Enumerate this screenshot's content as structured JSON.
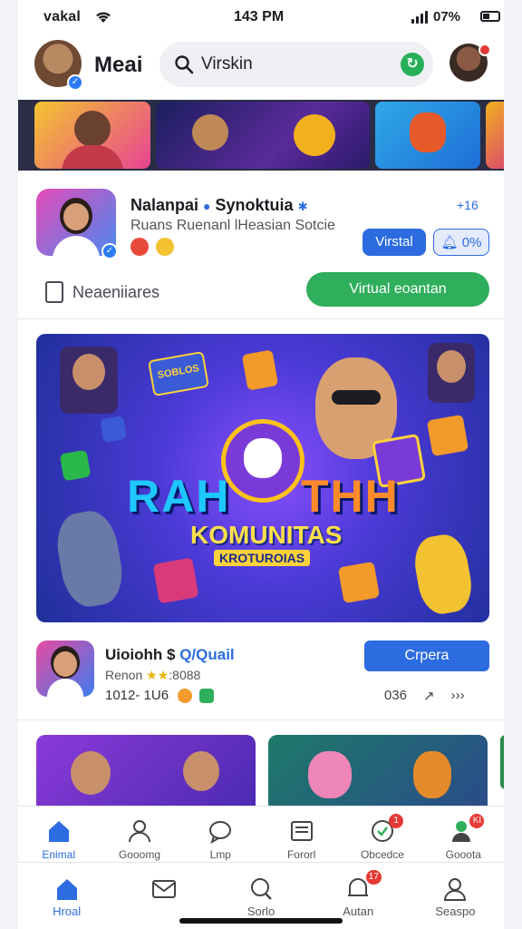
{
  "status_bar": {
    "carrier": "vakal",
    "time": "143 PM",
    "battery_text": "07%"
  },
  "header": {
    "app_title": "Meai",
    "search_value": "Virskin"
  },
  "profile_card": {
    "name": "Nalanpai",
    "name_suffix": "Synoktuia",
    "subtitle": "Ruans Ruenanl lHeasian Sotcie",
    "right_label": "+16",
    "chip_primary": "Virstal",
    "chip_secondary": "0%",
    "left_link": "Neaeniiares",
    "action_button": "Virtual eoantan"
  },
  "banner": {
    "word_left": "RAH",
    "word_right": "THH",
    "title": "KOMUNITAS",
    "subtitle": "KROTUROIAS",
    "badge_text": "SOBLOS"
  },
  "post": {
    "name": "Uioiohh $",
    "name_highlight": "Q/Quail",
    "meta_prefix": "Renon",
    "meta_stars": "★★",
    "meta_suffix": ":8088",
    "stats": "1012- 1U6",
    "open_button": "Crpera",
    "action_count": "036",
    "action_arrow": "↗",
    "action_more": "›››"
  },
  "nav_primary": [
    {
      "label": "Enimal",
      "icon": "home-icon",
      "active": true
    },
    {
      "label": "Gooomg",
      "icon": "people-icon",
      "active": false
    },
    {
      "label": "Lmp",
      "icon": "chat-icon",
      "active": false
    },
    {
      "label": "Fororl",
      "icon": "news-icon",
      "active": false
    },
    {
      "label": "Obcedce",
      "icon": "activity-icon",
      "badge": "1",
      "active": false
    },
    {
      "label": "Gooota",
      "icon": "friends-icon",
      "badge": "KI",
      "active": false
    }
  ],
  "nav_secondary": [
    {
      "label": "Hroal",
      "icon": "home-icon",
      "active": true
    },
    {
      "label": "",
      "icon": "inbox-icon",
      "active": false
    },
    {
      "label": "Sorlo",
      "icon": "search-icon",
      "active": false
    },
    {
      "label": "Autan",
      "icon": "notification-icon",
      "badge": "17",
      "active": false
    },
    {
      "label": "Seaspo",
      "icon": "profile-icon",
      "active": false
    }
  ],
  "colors": {
    "accent": "#2d6be0",
    "green": "#2fae5c",
    "alert": "#e53935"
  }
}
